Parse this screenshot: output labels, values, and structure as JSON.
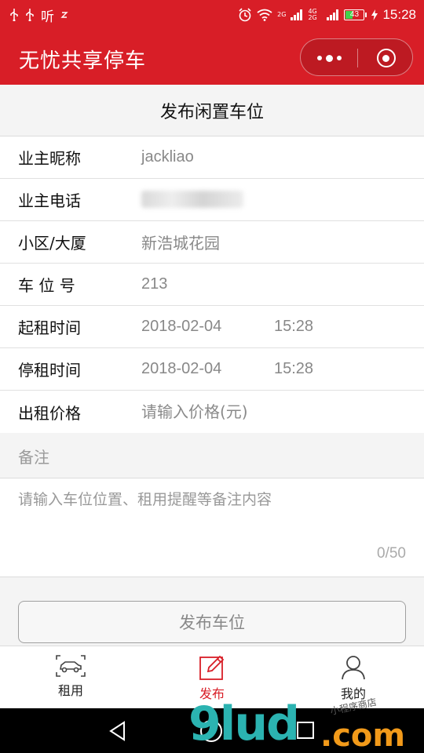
{
  "status_bar": {
    "carrier_text": "听",
    "battery": "43",
    "network_top": "2G",
    "network_4g": "4G 2G",
    "time": "15:28"
  },
  "header": {
    "title": "无忧共享停车"
  },
  "page": {
    "title": "发布闲置车位"
  },
  "form": {
    "owner_nickname": {
      "label": "业主昵称",
      "value": "jackliao"
    },
    "owner_phone": {
      "label": "业主电话"
    },
    "community": {
      "label": "小区/大厦",
      "value": "新浩城花园"
    },
    "space_no": {
      "label": "车 位 号",
      "value": "213"
    },
    "start_time": {
      "label": "起租时间",
      "date": "2018-02-04",
      "time": "15:28"
    },
    "end_time": {
      "label": "停租时间",
      "date": "2018-02-04",
      "time": "15:28"
    },
    "price": {
      "label": "出租价格",
      "value": "",
      "placeholder": "请输入价格(元)"
    }
  },
  "notes": {
    "heading": "备注",
    "value": "",
    "placeholder": "请输入车位位置、租用提醒等备注内容",
    "counter": "0/50"
  },
  "submit": {
    "label": "发布车位"
  },
  "tabbar": {
    "items": [
      {
        "label": "租用",
        "icon": "car-icon",
        "active": false
      },
      {
        "label": "发布",
        "icon": "edit-icon",
        "active": true
      },
      {
        "label": "我的",
        "icon": "user-icon",
        "active": false
      }
    ]
  },
  "watermark": {
    "main": "9lud",
    "suffix": ".com",
    "small": "小程序商店"
  },
  "colors": {
    "brand_red": "#d81e27",
    "text_gray": "#888888",
    "watermark_teal": "#2bb3b1",
    "watermark_orange": "#f29a1a"
  }
}
